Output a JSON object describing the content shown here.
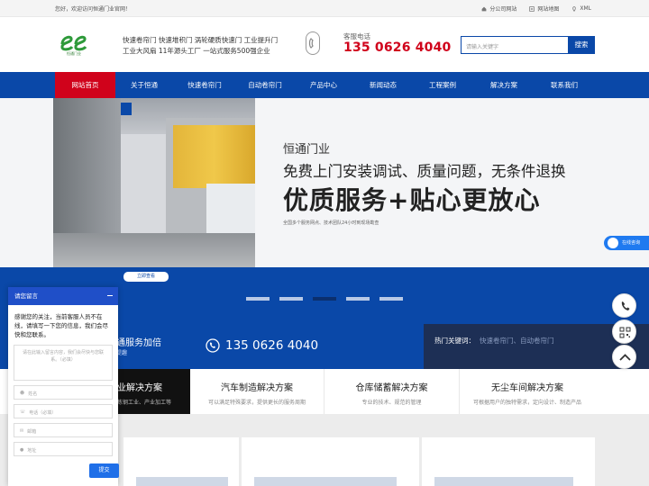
{
  "topbar": {
    "welcome": "您好，欢迎访问恒通门业官网！",
    "links": [
      {
        "icon": "home-icon",
        "label": "分公司网站"
      },
      {
        "icon": "sitemap-icon",
        "label": "网站地图"
      },
      {
        "icon": "location-pin-icon",
        "label": "XML"
      }
    ]
  },
  "header": {
    "logo_sub": "恒通门业",
    "slogan_line1": "快速卷帘门 快速堆积门 涡轮硬质快速门 工业提升门",
    "slogan_line2": "工业大风扇 11年源头工厂  一站式服务500强企业",
    "hotline_label": "客服电话",
    "hotline_number": "135 0626 4040",
    "search_placeholder": "请输入关键字",
    "search_button": "搜索"
  },
  "nav": {
    "items": [
      "网站首页",
      "关于恒通",
      "快速卷帘门",
      "自动卷帘门",
      "产品中心",
      "新闻动态",
      "工程案例",
      "解决方案",
      "联系我们"
    ],
    "active_index": 0
  },
  "banner": {
    "title1": "恒通门业",
    "title2": "免费上门安装调试、质量问题，无条件退换",
    "title3": "优质服务+贴心更放心",
    "note": "全国多个服务网点、技术团队24小时到现场勘查",
    "online_tab": "在线咨询",
    "more_button": "立即查看",
    "slides_total": 5,
    "slide_active": 2
  },
  "strip": {
    "left_text": "通服务加倍",
    "left_sub": "提趣",
    "phone": "135 0626 4040",
    "keywords_label": "热门关键词：",
    "keywords": "快速卷帘门、自动卷帘门"
  },
  "solutions": [
    {
      "title": "业解决方案",
      "desc": "炼钢工业、产业加工等"
    },
    {
      "title": "汽车制造解决方案",
      "desc": "可以满足特殊要求，提供更长的服务周期"
    },
    {
      "title": "仓库储蓄解决方案",
      "desc": "专业的技术、规范的管理"
    },
    {
      "title": "无尘车间解决方案",
      "desc": "可根据用户的独特需求，定向设计、制造产品"
    }
  ],
  "chat": {
    "title": "请您留言",
    "message": "感谢您的关注，当前客服人员不在线，请填写一下您的信息，我们会尽快和您联系。",
    "textarea_placeholder": "请在此输入留言内容，我们会尽快与您联系。（必填）",
    "fields": [
      {
        "icon": "user-icon",
        "label": "姓名"
      },
      {
        "icon": "phone-icon",
        "label": "电话（必填）"
      },
      {
        "icon": "mail-icon",
        "label": "邮箱"
      },
      {
        "icon": "location-icon",
        "label": "地址"
      }
    ],
    "submit": "提交"
  },
  "colors": {
    "primary_blue": "#0a48a8",
    "active_red": "#d0021b",
    "hotline_red": "#d0021b",
    "chat_blue": "#1f4fc8"
  }
}
